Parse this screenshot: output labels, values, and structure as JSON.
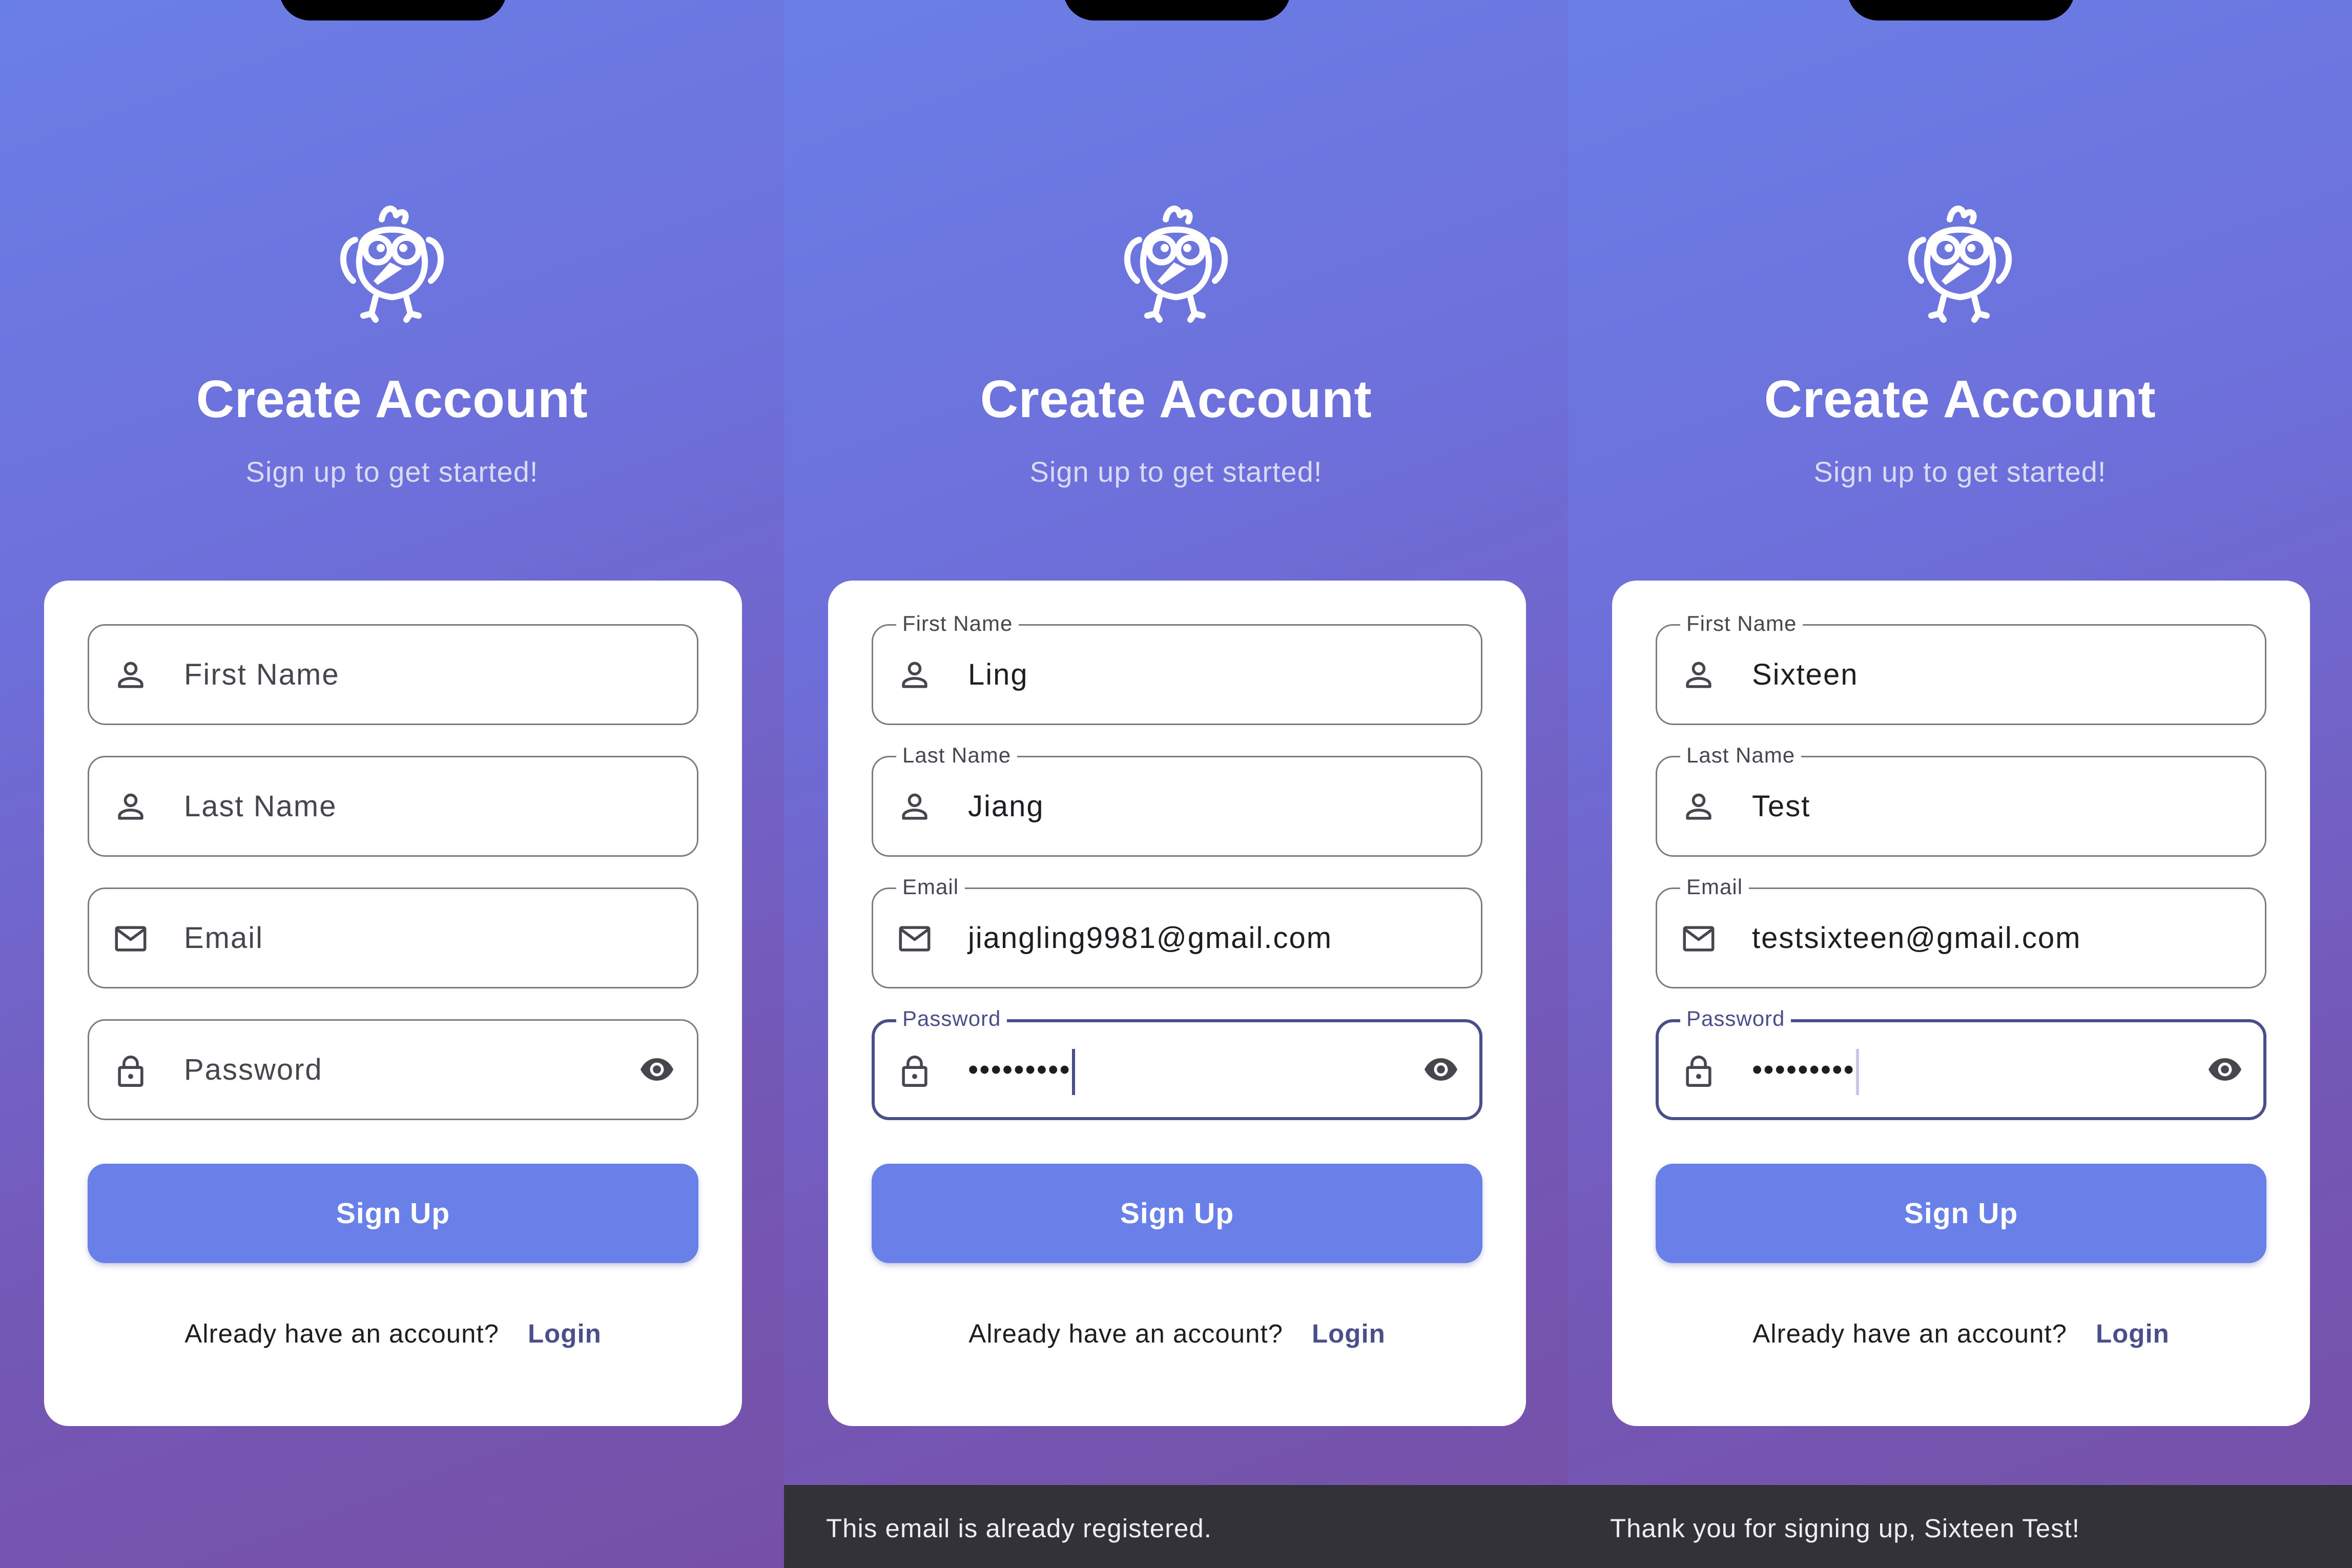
{
  "app": {
    "title": "Create Account",
    "subtitle": "Sign up to get started!",
    "sign_up_label": "Sign Up",
    "footer_text": "Already have an account?",
    "login_label": "Login",
    "colors": {
      "primary": "#6880e8",
      "focus": "#4a4f8a",
      "gradient_top": "#6a7fe6",
      "gradient_bottom": "#7650a7",
      "snackbar": "#333238"
    }
  },
  "labels": {
    "first_name": "First Name",
    "last_name": "Last Name",
    "email": "Email",
    "password": "Password"
  },
  "screens": [
    {
      "first_name": "",
      "last_name": "",
      "email": "",
      "password": "",
      "snackbar": ""
    },
    {
      "first_name": "Ling",
      "last_name": "Jiang",
      "email": "jiangling9981@gmail.com",
      "password": "•••••••••",
      "snackbar": "This email is already registered."
    },
    {
      "first_name": "Sixteen",
      "last_name": "Test",
      "email": "testsixteen@gmail.com",
      "password": "•••••••••",
      "snackbar": "Thank you for signing up, Sixteen Test!"
    }
  ]
}
